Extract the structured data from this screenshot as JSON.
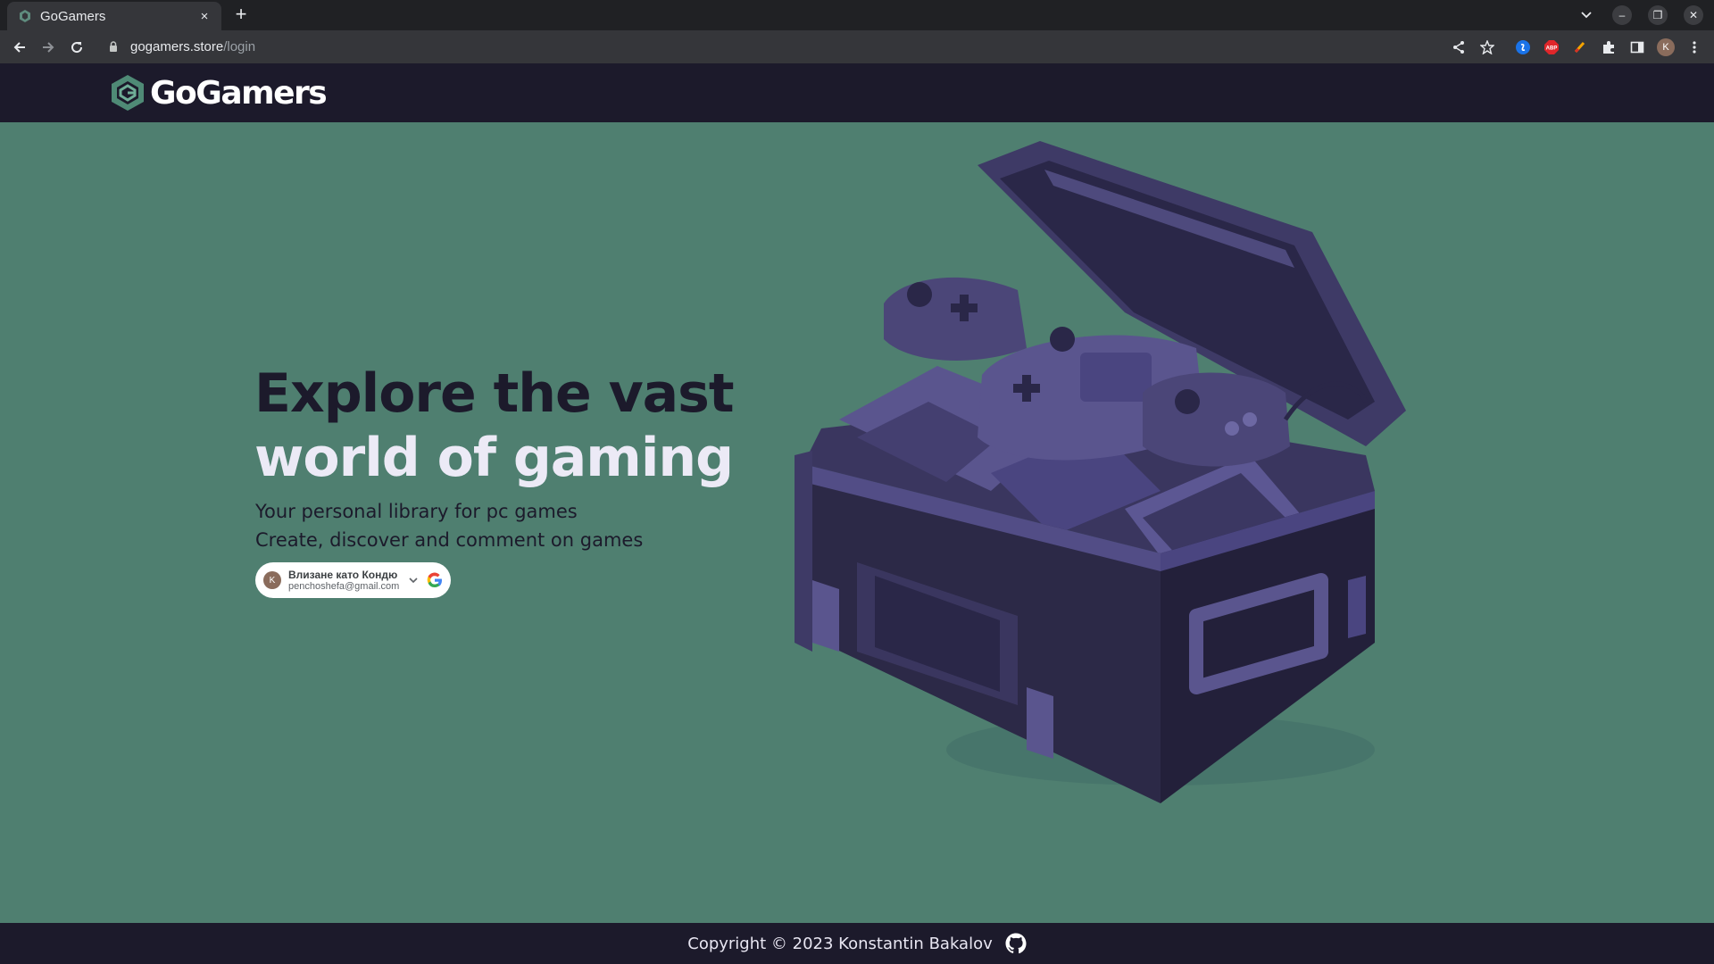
{
  "browser": {
    "tab_title": "GoGamers",
    "tab_close": "×",
    "new_tab": "+",
    "url_host": "gogamers.store",
    "url_path": "/login",
    "profile_initial": "K",
    "window_controls": {
      "minimize": "–",
      "restore": "❐",
      "close": "✕"
    }
  },
  "header": {
    "logo_text": "GoGamers",
    "brand_color": "#4f7f70"
  },
  "hero": {
    "title_line_1": "Explore the vast",
    "title_line_2": "world of gaming",
    "subtitle_1": "Your personal library for pc games",
    "subtitle_2": "Create, discover and comment on games"
  },
  "google_signin": {
    "avatar_initial": "K",
    "name_label": "Влизане като Кондю",
    "email": "penchoshefa@gmail.com"
  },
  "illustration": {
    "subject": "open treasure chest full of game controllers and game cartridges"
  },
  "footer": {
    "copyright": "Copyright © 2023 Konstantin Bakalov",
    "github_icon": "github-icon"
  },
  "colors": {
    "page_background": "#4f7f70",
    "header_footer_background": "#1c1a2b",
    "chest_purple": "#4b4678"
  }
}
